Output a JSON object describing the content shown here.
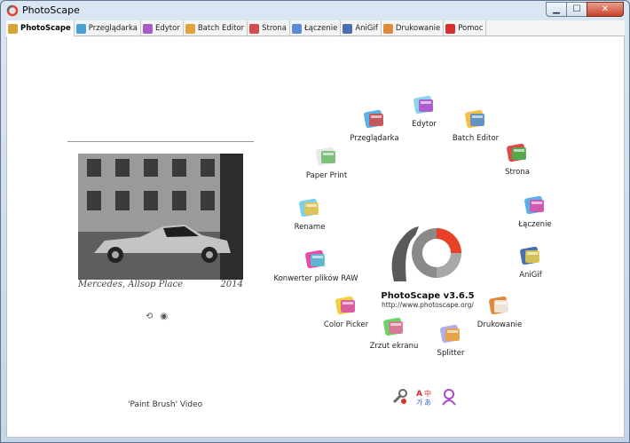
{
  "window": {
    "title": "PhotoScape",
    "controls": {
      "minimize": "▁",
      "maximize": "☐",
      "close": "✕"
    }
  },
  "tabs": [
    {
      "label": "PhotoScape",
      "active": true,
      "color": "#d9a33b"
    },
    {
      "label": "Przeglądarka",
      "active": false,
      "color": "#4aa0d6"
    },
    {
      "label": "Edytor",
      "active": false,
      "color": "#a65cc8"
    },
    {
      "label": "Batch Editor",
      "active": false,
      "color": "#e0a23c"
    },
    {
      "label": "Strona",
      "active": false,
      "color": "#d64b4b"
    },
    {
      "label": "Łączenie",
      "active": false,
      "color": "#5a8bd6"
    },
    {
      "label": "AniGif",
      "active": false,
      "color": "#4a6fb0"
    },
    {
      "label": "Drukowanie",
      "active": false,
      "color": "#e08a3c"
    },
    {
      "label": "Pomoc",
      "active": false,
      "color": "#d63030"
    }
  ],
  "photo": {
    "caption": "Mercedes, Allsop Place",
    "date": "2014"
  },
  "video_link": "'Paint Brush' Video",
  "menu": [
    {
      "label": "Edytor",
      "icon": "camera-icon"
    },
    {
      "label": "Batch Editor",
      "icon": "folders-icon"
    },
    {
      "label": "Strona",
      "icon": "page-layout-icon"
    },
    {
      "label": "Łączenie",
      "icon": "combine-icon"
    },
    {
      "label": "AniGif",
      "icon": "animated-gif-icon"
    },
    {
      "label": "Drukowanie",
      "icon": "print-icon"
    },
    {
      "label": "Splitter",
      "icon": "splitter-icon"
    },
    {
      "label": "Zrzut ekranu",
      "icon": "screen-capture-icon"
    },
    {
      "label": "Color Picker",
      "icon": "color-picker-icon"
    },
    {
      "label": "Konwerter plików RAW",
      "icon": "raw-converter-icon"
    },
    {
      "label": "Rename",
      "icon": "rename-icon"
    },
    {
      "label": "Paper Print",
      "icon": "paper-print-icon"
    },
    {
      "label": "Przeglądarka",
      "icon": "viewer-icon"
    }
  ],
  "logo": {
    "version": "PhotoScape v3.6.5",
    "url": "http://www.photoscape.org/"
  },
  "colors": {
    "logo_red": "#e8412a",
    "logo_gray": "#8a8a8a",
    "logo_dark": "#5a5a5a"
  }
}
